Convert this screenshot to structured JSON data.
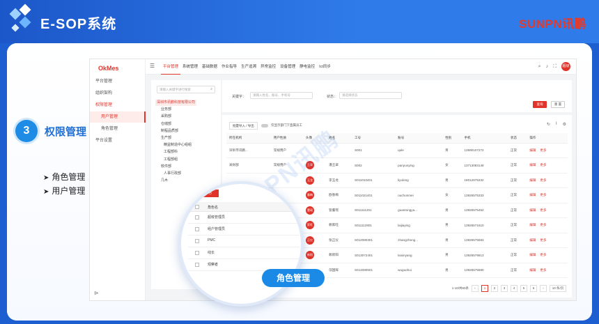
{
  "header": {
    "title": "E-SOP系统",
    "brand_a": "SUNPN",
    "brand_b": "讯鹏"
  },
  "step": {
    "number": "3",
    "title": "权限管理",
    "bullets": [
      "角色管理",
      "用户管理"
    ]
  },
  "app": {
    "logo": "OkMes",
    "sidebar": [
      {
        "label": "平台管理",
        "kind": "top"
      },
      {
        "label": "组织架构",
        "kind": "top"
      },
      {
        "label": "权限管理",
        "kind": "active"
      },
      {
        "label": "用户管理",
        "kind": "sel"
      },
      {
        "label": "角色管理",
        "kind": "sub"
      },
      {
        "label": "平台设置",
        "kind": "top"
      }
    ],
    "nav": [
      "平台管理",
      "系统管理",
      "基础数据",
      "作业指导",
      "生产追溯",
      "异常监控",
      "设备管理",
      "静电监控",
      "Ict同步"
    ],
    "avatar": "超级",
    "tree": {
      "search_placeholder": "请输入关键字进行搜索",
      "nodes": [
        "深圳市讯鹏科技有限公司",
        "业务部",
        "采购部",
        "仓储部",
        "制程品质部",
        "生产部",
        "精益制造中心组组",
        "工程部科",
        "工程部组",
        "软件部",
        "人事行政部",
        "几木"
      ]
    },
    "filter": {
      "keyword_label": "关键字：",
      "keyword_placeholder": "请输入姓名、账号、手机号",
      "status_label": "状态：",
      "status_placeholder": "请选择状态",
      "query": "查询",
      "reset": "重 置"
    },
    "toolbar": {
      "import": "批量导入 / 导出",
      "toggle_label": "仅显示部门下直属员工"
    },
    "table": {
      "headers": [
        "所在机构",
        "用户性质",
        "头像",
        "姓名",
        "工号",
        "账号",
        "性别",
        "手机",
        "状态",
        "操作"
      ],
      "rows": [
        [
          "深圳市讯鹏...",
          "常规用户",
          "",
          "",
          "S001",
          "qule",
          "男",
          "13590107272",
          "正常",
          "编辑",
          "更多"
        ],
        [
          "采财部",
          "常规用户",
          "王翠",
          "潘王翠",
          "S002",
          "panyunying",
          "女",
          "13713083148",
          "正常",
          "编辑",
          "更多"
        ],
        [
          "",
          "",
          "玉龙",
          "李玉龙",
          "S011010401",
          "liyulong",
          "男",
          "18012675332",
          "正常",
          "编辑",
          "更多"
        ],
        [
          "",
          "",
          "春梅",
          "欧春梅",
          "S011021401",
          "ouchunmei",
          "女",
          "13926575333",
          "正常",
          "编辑",
          "更多"
        ],
        [
          "",
          "",
          "董瑶",
          "管董瑶",
          "S011111201",
          "guantongya...",
          "男",
          "13926575452",
          "正常",
          "编辑",
          "更多"
        ],
        [
          "",
          "",
          "家旺",
          "赖家旺",
          "S011112801",
          "laijiaying",
          "男",
          "13926571610",
          "正常",
          "编辑",
          "更多"
        ],
        [
          "",
          "",
          "正仪",
          "张正仪",
          "S012080301",
          "zhangzheng...",
          "男",
          "13926575583",
          "正常",
          "编辑",
          "更多"
        ],
        [
          "",
          "",
          "新阳",
          "赖新阳",
          "S013072401",
          "laixinyang",
          "男",
          "13926579813",
          "正常",
          "编辑",
          "更多"
        ],
        [
          "",
          "",
          "",
          "邬国辉",
          "S014080501",
          "wuguohui",
          "男",
          "13926575580",
          "正常",
          "编辑",
          "更多"
        ]
      ]
    },
    "pager": {
      "total": "1-10/共60条",
      "pages": [
        "1",
        "2",
        "3",
        "4",
        "5",
        "6"
      ],
      "size": "10 条/页"
    }
  },
  "lens": {
    "add_button": "添加角色",
    "header": "角色名",
    "rows": [
      "超级管理员",
      "组户管理员",
      "PMC",
      "线长",
      "观察者"
    ],
    "badge": "角色管理"
  },
  "watermark": "SUNPN讯鹏"
}
